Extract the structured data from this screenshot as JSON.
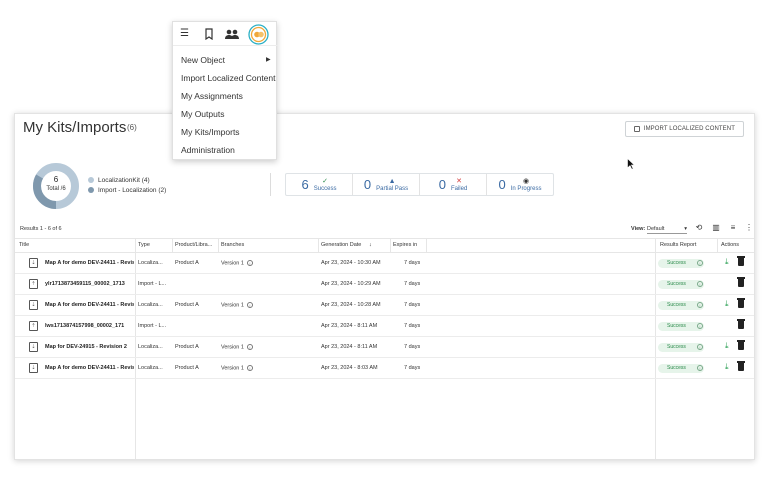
{
  "menu": {
    "icons": [
      "hamburger-icon",
      "bookmarks-icon",
      "users-icon",
      "app-logo"
    ],
    "items": [
      {
        "label": "New Object",
        "has_submenu": true
      },
      {
        "label": "Import Localized Content"
      },
      {
        "label": "My Assignments"
      },
      {
        "label": "My Outputs"
      },
      {
        "label": "My Kits/Imports"
      },
      {
        "label": "Administration"
      }
    ]
  },
  "header": {
    "title": "My Kits/Imports",
    "count": "(6)",
    "import_button": "IMPORT LOCALIZED CONTENT"
  },
  "summary": {
    "total": "6",
    "total_label": "Total /6",
    "legend": [
      {
        "label": "LocalizationKit (4)",
        "color": "#b7c9d8",
        "value": 4
      },
      {
        "label": "Import - Localization (2)",
        "color": "#7f98ad",
        "value": 2
      }
    ]
  },
  "stats": [
    {
      "value": "6",
      "label": "Success",
      "mark": "✓",
      "mark_color": "#2a8a4a"
    },
    {
      "value": "0",
      "label": "Partial Pass",
      "mark": "▲",
      "mark_color": "#3a6aa3"
    },
    {
      "value": "0",
      "label": "Failed",
      "mark": "✕",
      "mark_color": "#d23b3b"
    },
    {
      "value": "0",
      "label": "In Progress",
      "mark": "◉",
      "mark_color": "#333333"
    }
  ],
  "toolbar": {
    "results": "Results 1 - 6 of 6",
    "view_label": "View:",
    "view_value": "Default"
  },
  "table": {
    "headers": [
      "Title",
      "Type",
      "Product/Libra...",
      "Branches",
      "Generation Date",
      "Expires in",
      "Results Report",
      "Actions"
    ],
    "rows": [
      {
        "title": "Map A for demo DEV-24411 - Revisi",
        "type": "Localiza...",
        "product": "Product A",
        "branch": "Version 1",
        "date": "Apr 23, 2024 - 10:30 AM",
        "expires": "7 days",
        "status": "Success",
        "download": true,
        "kind": "kit"
      },
      {
        "title": "ylr1713873459115_00002_1713",
        "type": "Import - L...",
        "product": "",
        "branch": "",
        "date": "Apr 23, 2024 - 10:29 AM",
        "expires": "7 days",
        "status": "Success",
        "download": false,
        "kind": "import"
      },
      {
        "title": "Map A for demo DEV-24411 - Revisi",
        "type": "Localiza...",
        "product": "Product A",
        "branch": "Version 1",
        "date": "Apr 23, 2024 - 10:28 AM",
        "expires": "7 days",
        "status": "Success",
        "download": true,
        "kind": "kit"
      },
      {
        "title": "lws1713874157998_00002_171",
        "type": "Import - L...",
        "product": "",
        "branch": "",
        "date": "Apr 23, 2024 - 8:11 AM",
        "expires": "7 days",
        "status": "Success",
        "download": false,
        "kind": "import"
      },
      {
        "title": "Map for DEV-24915 - Revision 2",
        "type": "Localiza...",
        "product": "Product A",
        "branch": "Version 1",
        "date": "Apr 23, 2024 - 8:11 AM",
        "expires": "7 days",
        "status": "Success",
        "download": true,
        "kind": "kit"
      },
      {
        "title": "Map A for demo DEV-24411 - Revisi",
        "type": "Localiza...",
        "product": "Product A",
        "branch": "Version 1",
        "date": "Apr 23, 2024 - 8:03 AM",
        "expires": "7 days",
        "status": "Success",
        "download": true,
        "kind": "kit"
      }
    ]
  }
}
